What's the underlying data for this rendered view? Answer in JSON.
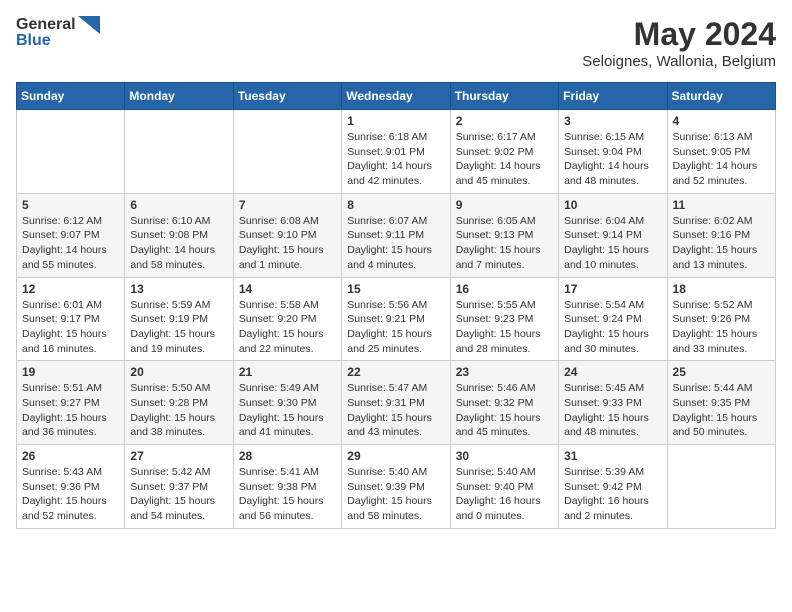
{
  "header": {
    "logo_general": "General",
    "logo_blue": "Blue",
    "month_year": "May 2024",
    "location": "Seloignes, Wallonia, Belgium"
  },
  "weekdays": [
    "Sunday",
    "Monday",
    "Tuesday",
    "Wednesday",
    "Thursday",
    "Friday",
    "Saturday"
  ],
  "weeks": [
    [
      {
        "day": "",
        "sunrise": "",
        "sunset": "",
        "daylight": ""
      },
      {
        "day": "",
        "sunrise": "",
        "sunset": "",
        "daylight": ""
      },
      {
        "day": "",
        "sunrise": "",
        "sunset": "",
        "daylight": ""
      },
      {
        "day": "1",
        "sunrise": "Sunrise: 6:18 AM",
        "sunset": "Sunset: 9:01 PM",
        "daylight": "Daylight: 14 hours and 42 minutes."
      },
      {
        "day": "2",
        "sunrise": "Sunrise: 6:17 AM",
        "sunset": "Sunset: 9:02 PM",
        "daylight": "Daylight: 14 hours and 45 minutes."
      },
      {
        "day": "3",
        "sunrise": "Sunrise: 6:15 AM",
        "sunset": "Sunset: 9:04 PM",
        "daylight": "Daylight: 14 hours and 48 minutes."
      },
      {
        "day": "4",
        "sunrise": "Sunrise: 6:13 AM",
        "sunset": "Sunset: 9:05 PM",
        "daylight": "Daylight: 14 hours and 52 minutes."
      }
    ],
    [
      {
        "day": "5",
        "sunrise": "Sunrise: 6:12 AM",
        "sunset": "Sunset: 9:07 PM",
        "daylight": "Daylight: 14 hours and 55 minutes."
      },
      {
        "day": "6",
        "sunrise": "Sunrise: 6:10 AM",
        "sunset": "Sunset: 9:08 PM",
        "daylight": "Daylight: 14 hours and 58 minutes."
      },
      {
        "day": "7",
        "sunrise": "Sunrise: 6:08 AM",
        "sunset": "Sunset: 9:10 PM",
        "daylight": "Daylight: 15 hours and 1 minute."
      },
      {
        "day": "8",
        "sunrise": "Sunrise: 6:07 AM",
        "sunset": "Sunset: 9:11 PM",
        "daylight": "Daylight: 15 hours and 4 minutes."
      },
      {
        "day": "9",
        "sunrise": "Sunrise: 6:05 AM",
        "sunset": "Sunset: 9:13 PM",
        "daylight": "Daylight: 15 hours and 7 minutes."
      },
      {
        "day": "10",
        "sunrise": "Sunrise: 6:04 AM",
        "sunset": "Sunset: 9:14 PM",
        "daylight": "Daylight: 15 hours and 10 minutes."
      },
      {
        "day": "11",
        "sunrise": "Sunrise: 6:02 AM",
        "sunset": "Sunset: 9:16 PM",
        "daylight": "Daylight: 15 hours and 13 minutes."
      }
    ],
    [
      {
        "day": "12",
        "sunrise": "Sunrise: 6:01 AM",
        "sunset": "Sunset: 9:17 PM",
        "daylight": "Daylight: 15 hours and 16 minutes."
      },
      {
        "day": "13",
        "sunrise": "Sunrise: 5:59 AM",
        "sunset": "Sunset: 9:19 PM",
        "daylight": "Daylight: 15 hours and 19 minutes."
      },
      {
        "day": "14",
        "sunrise": "Sunrise: 5:58 AM",
        "sunset": "Sunset: 9:20 PM",
        "daylight": "Daylight: 15 hours and 22 minutes."
      },
      {
        "day": "15",
        "sunrise": "Sunrise: 5:56 AM",
        "sunset": "Sunset: 9:21 PM",
        "daylight": "Daylight: 15 hours and 25 minutes."
      },
      {
        "day": "16",
        "sunrise": "Sunrise: 5:55 AM",
        "sunset": "Sunset: 9:23 PM",
        "daylight": "Daylight: 15 hours and 28 minutes."
      },
      {
        "day": "17",
        "sunrise": "Sunrise: 5:54 AM",
        "sunset": "Sunset: 9:24 PM",
        "daylight": "Daylight: 15 hours and 30 minutes."
      },
      {
        "day": "18",
        "sunrise": "Sunrise: 5:52 AM",
        "sunset": "Sunset: 9:26 PM",
        "daylight": "Daylight: 15 hours and 33 minutes."
      }
    ],
    [
      {
        "day": "19",
        "sunrise": "Sunrise: 5:51 AM",
        "sunset": "Sunset: 9:27 PM",
        "daylight": "Daylight: 15 hours and 36 minutes."
      },
      {
        "day": "20",
        "sunrise": "Sunrise: 5:50 AM",
        "sunset": "Sunset: 9:28 PM",
        "daylight": "Daylight: 15 hours and 38 minutes."
      },
      {
        "day": "21",
        "sunrise": "Sunrise: 5:49 AM",
        "sunset": "Sunset: 9:30 PM",
        "daylight": "Daylight: 15 hours and 41 minutes."
      },
      {
        "day": "22",
        "sunrise": "Sunrise: 5:47 AM",
        "sunset": "Sunset: 9:31 PM",
        "daylight": "Daylight: 15 hours and 43 minutes."
      },
      {
        "day": "23",
        "sunrise": "Sunrise: 5:46 AM",
        "sunset": "Sunset: 9:32 PM",
        "daylight": "Daylight: 15 hours and 45 minutes."
      },
      {
        "day": "24",
        "sunrise": "Sunrise: 5:45 AM",
        "sunset": "Sunset: 9:33 PM",
        "daylight": "Daylight: 15 hours and 48 minutes."
      },
      {
        "day": "25",
        "sunrise": "Sunrise: 5:44 AM",
        "sunset": "Sunset: 9:35 PM",
        "daylight": "Daylight: 15 hours and 50 minutes."
      }
    ],
    [
      {
        "day": "26",
        "sunrise": "Sunrise: 5:43 AM",
        "sunset": "Sunset: 9:36 PM",
        "daylight": "Daylight: 15 hours and 52 minutes."
      },
      {
        "day": "27",
        "sunrise": "Sunrise: 5:42 AM",
        "sunset": "Sunset: 9:37 PM",
        "daylight": "Daylight: 15 hours and 54 minutes."
      },
      {
        "day": "28",
        "sunrise": "Sunrise: 5:41 AM",
        "sunset": "Sunset: 9:38 PM",
        "daylight": "Daylight: 15 hours and 56 minutes."
      },
      {
        "day": "29",
        "sunrise": "Sunrise: 5:40 AM",
        "sunset": "Sunset: 9:39 PM",
        "daylight": "Daylight: 15 hours and 58 minutes."
      },
      {
        "day": "30",
        "sunrise": "Sunrise: 5:40 AM",
        "sunset": "Sunset: 9:40 PM",
        "daylight": "Daylight: 16 hours and 0 minutes."
      },
      {
        "day": "31",
        "sunrise": "Sunrise: 5:39 AM",
        "sunset": "Sunset: 9:42 PM",
        "daylight": "Daylight: 16 hours and 2 minutes."
      },
      {
        "day": "",
        "sunrise": "",
        "sunset": "",
        "daylight": ""
      }
    ]
  ]
}
